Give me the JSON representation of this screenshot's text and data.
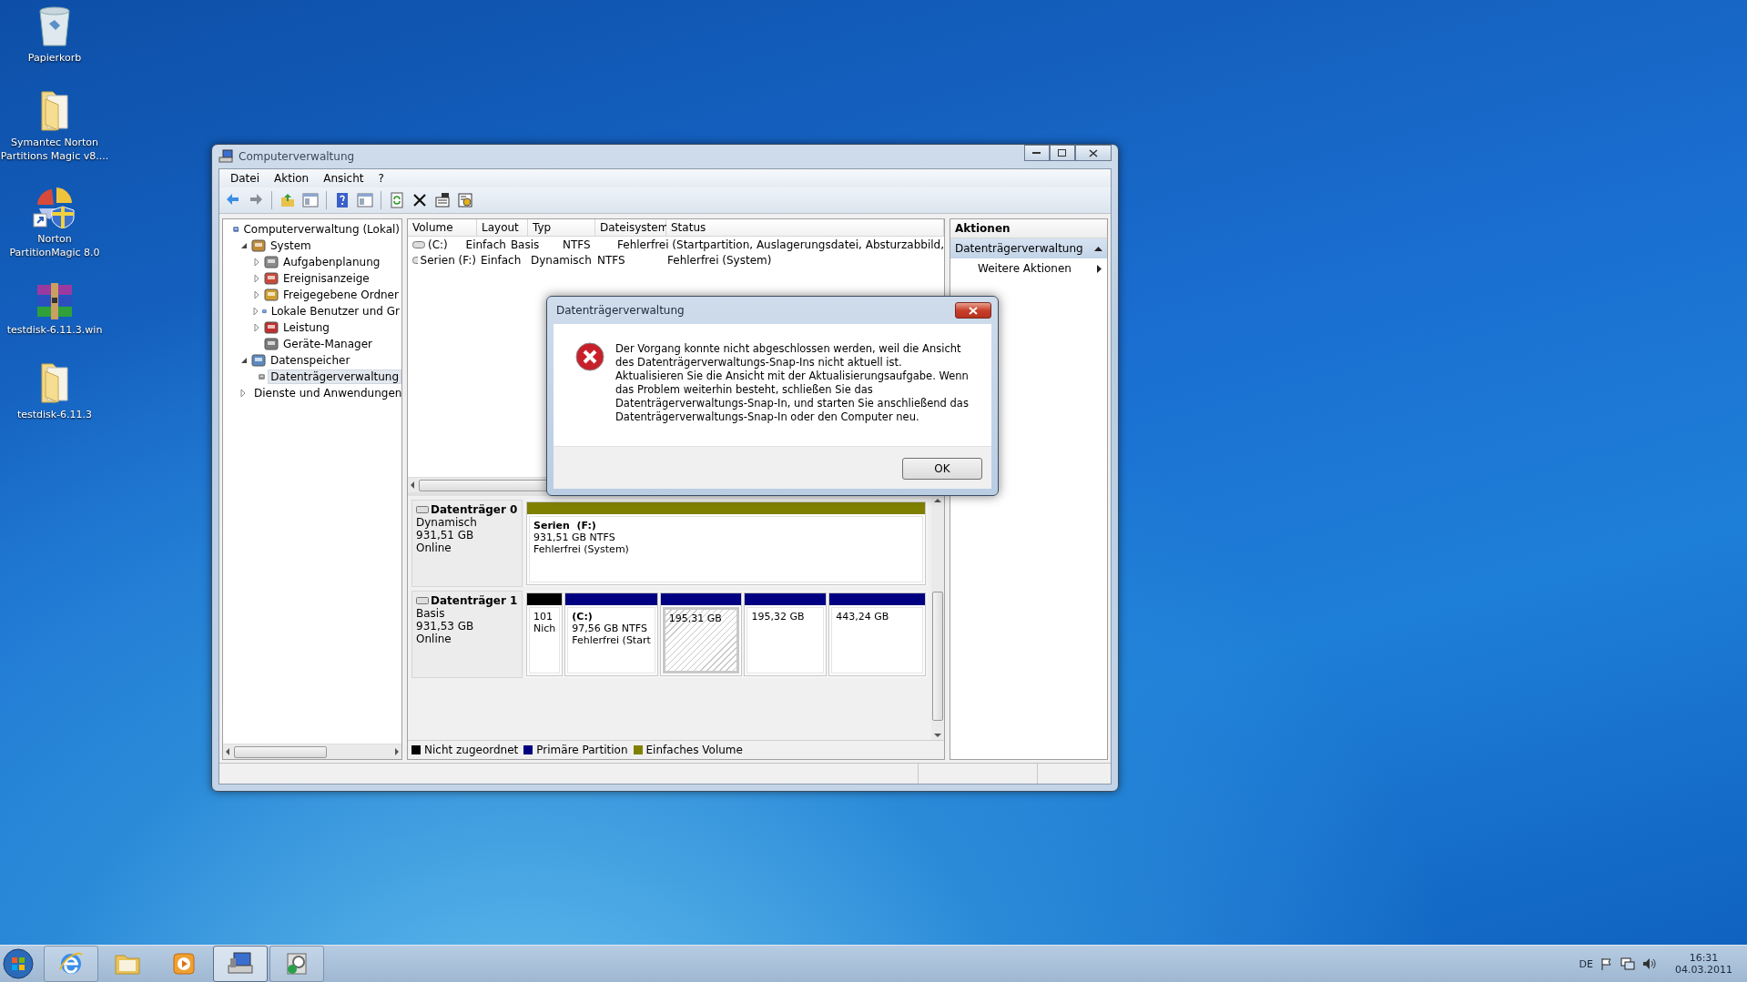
{
  "desktop_icons": [
    {
      "kind": "recycle-bin",
      "label_lines": [
        "Papierkorb"
      ]
    },
    {
      "kind": "folder",
      "label_lines": [
        "Symantec Norton",
        "Partitions Magic v8...."
      ]
    },
    {
      "kind": "partition-app",
      "label_lines": [
        "Norton",
        "PartitionMagic 8.0"
      ]
    },
    {
      "kind": "archive",
      "label_lines": [
        "testdisk-6.11.3.win"
      ]
    },
    {
      "kind": "folder",
      "label_lines": [
        "testdisk-6.11.3"
      ]
    }
  ],
  "window": {
    "title": "Computerverwaltung",
    "menu": [
      "Datei",
      "Aktion",
      "Ansicht",
      "?"
    ],
    "toolbar": [
      {
        "kind": "back"
      },
      {
        "kind": "forward"
      },
      {
        "kind": "separator"
      },
      {
        "kind": "up"
      },
      {
        "kind": "pane"
      },
      {
        "kind": "separator"
      },
      {
        "kind": "help"
      },
      {
        "kind": "pane"
      },
      {
        "kind": "separator"
      },
      {
        "kind": "refresh"
      },
      {
        "kind": "delete"
      },
      {
        "kind": "properties"
      },
      {
        "kind": "settings"
      }
    ],
    "tree": [
      {
        "label": "Computerverwaltung (Lokal)",
        "selected": false,
        "children": [
          {
            "label": "System",
            "selected": false,
            "expanded": true,
            "children": [
              {
                "label": "Aufgabenplanung",
                "selected": false,
                "expanded": false
              },
              {
                "label": "Ereignisanzeige",
                "selected": false,
                "expanded": false
              },
              {
                "label": "Freigegebene Ordner",
                "selected": false,
                "expanded": false
              },
              {
                "label": "Lokale Benutzer und Gr",
                "selected": false,
                "expanded": false
              },
              {
                "label": "Leistung",
                "selected": false,
                "expanded": false
              },
              {
                "label": "Geräte-Manager",
                "selected": false
              }
            ]
          },
          {
            "label": "Datenspeicher",
            "selected": false,
            "expanded": true,
            "children": [
              {
                "label": "Datenträgerverwaltung",
                "selected": true
              }
            ]
          },
          {
            "label": "Dienste und Anwendungen",
            "selected": false,
            "expanded": false
          }
        ]
      }
    ],
    "volumes": {
      "columns": [
        "Volume",
        "Layout",
        "Typ",
        "Dateisystem",
        "Status"
      ],
      "rows": [
        [
          "(C:)",
          "Einfach",
          "Basis",
          "NTFS",
          "Fehlerfrei (Startpartition, Auslagerungsdatei, Absturzabbild,"
        ],
        [
          "Serien (F:)",
          "Einfach",
          "Dynamisch",
          "NTFS",
          "Fehlerfrei (System)"
        ]
      ]
    },
    "disks": [
      {
        "name": "Datenträger 0",
        "type": "Dynamisch",
        "size": "931,51 GB",
        "status": "Online",
        "partitions": [
          {
            "color": "#808000",
            "selected": false,
            "name": "Serien  (F:)",
            "lines": [
              "931,51 GB NTFS",
              "Fehlerfrei (System)"
            ]
          }
        ]
      },
      {
        "name": "Datenträger 1",
        "type": "Basis",
        "size": "931,53 GB",
        "status": "Online",
        "partitions": [
          {
            "color": "#000000",
            "selected": false,
            "lines": [
              "101",
              "Nich"
            ]
          },
          {
            "color": "#000080",
            "selected": false,
            "name": "(C:)",
            "lines": [
              "97,56 GB NTFS",
              "Fehlerfrei (Start"
            ]
          },
          {
            "color": "#000080",
            "selected": true,
            "lines": [
              "195,31 GB"
            ]
          },
          {
            "color": "#000080",
            "selected": false,
            "lines": [
              "195,32 GB"
            ]
          },
          {
            "color": "#000080",
            "selected": false,
            "lines": [
              "443,24 GB"
            ]
          }
        ]
      }
    ],
    "legend": [
      {
        "label": "Nicht zugeordnet",
        "color": "#000000"
      },
      {
        "label": "Primäre Partition",
        "color": "#000080"
      },
      {
        "label": "Einfaches Volume",
        "color": "#808000"
      }
    ],
    "actions": {
      "title": "Aktionen",
      "section": {
        "label": "Datenträgerverwaltung",
        "expanded": true
      },
      "items": [
        "Weitere Aktionen"
      ]
    }
  },
  "dialog": {
    "title": "Datenträgerverwaltung",
    "message": "Der Vorgang konnte nicht abgeschlossen werden, weil die Ansicht des Datenträgerverwaltungs-Snap-Ins nicht aktuell ist. Aktualisieren Sie die Ansicht mit der Aktualisierungsaufgabe. Wenn das Problem weiterhin besteht, schließen Sie das Datenträgerverwaltungs-Snap-In, und starten Sie anschließend das Datenträgerverwaltungs-Snap-In oder den Computer neu.",
    "buttons": [
      "OK"
    ]
  },
  "taskbar": {
    "apps": [
      {
        "kind": "browser",
        "running": true,
        "selected": false
      },
      {
        "kind": "explorer",
        "running": false,
        "selected": false
      },
      {
        "kind": "media",
        "running": false,
        "selected": false
      },
      {
        "kind": "computer-management",
        "running": true,
        "selected": true
      },
      {
        "kind": "partition-tool",
        "running": true,
        "selected": false
      }
    ],
    "tray": {
      "language": "DE",
      "time": "16:31",
      "date": "04.03.2011"
    }
  }
}
